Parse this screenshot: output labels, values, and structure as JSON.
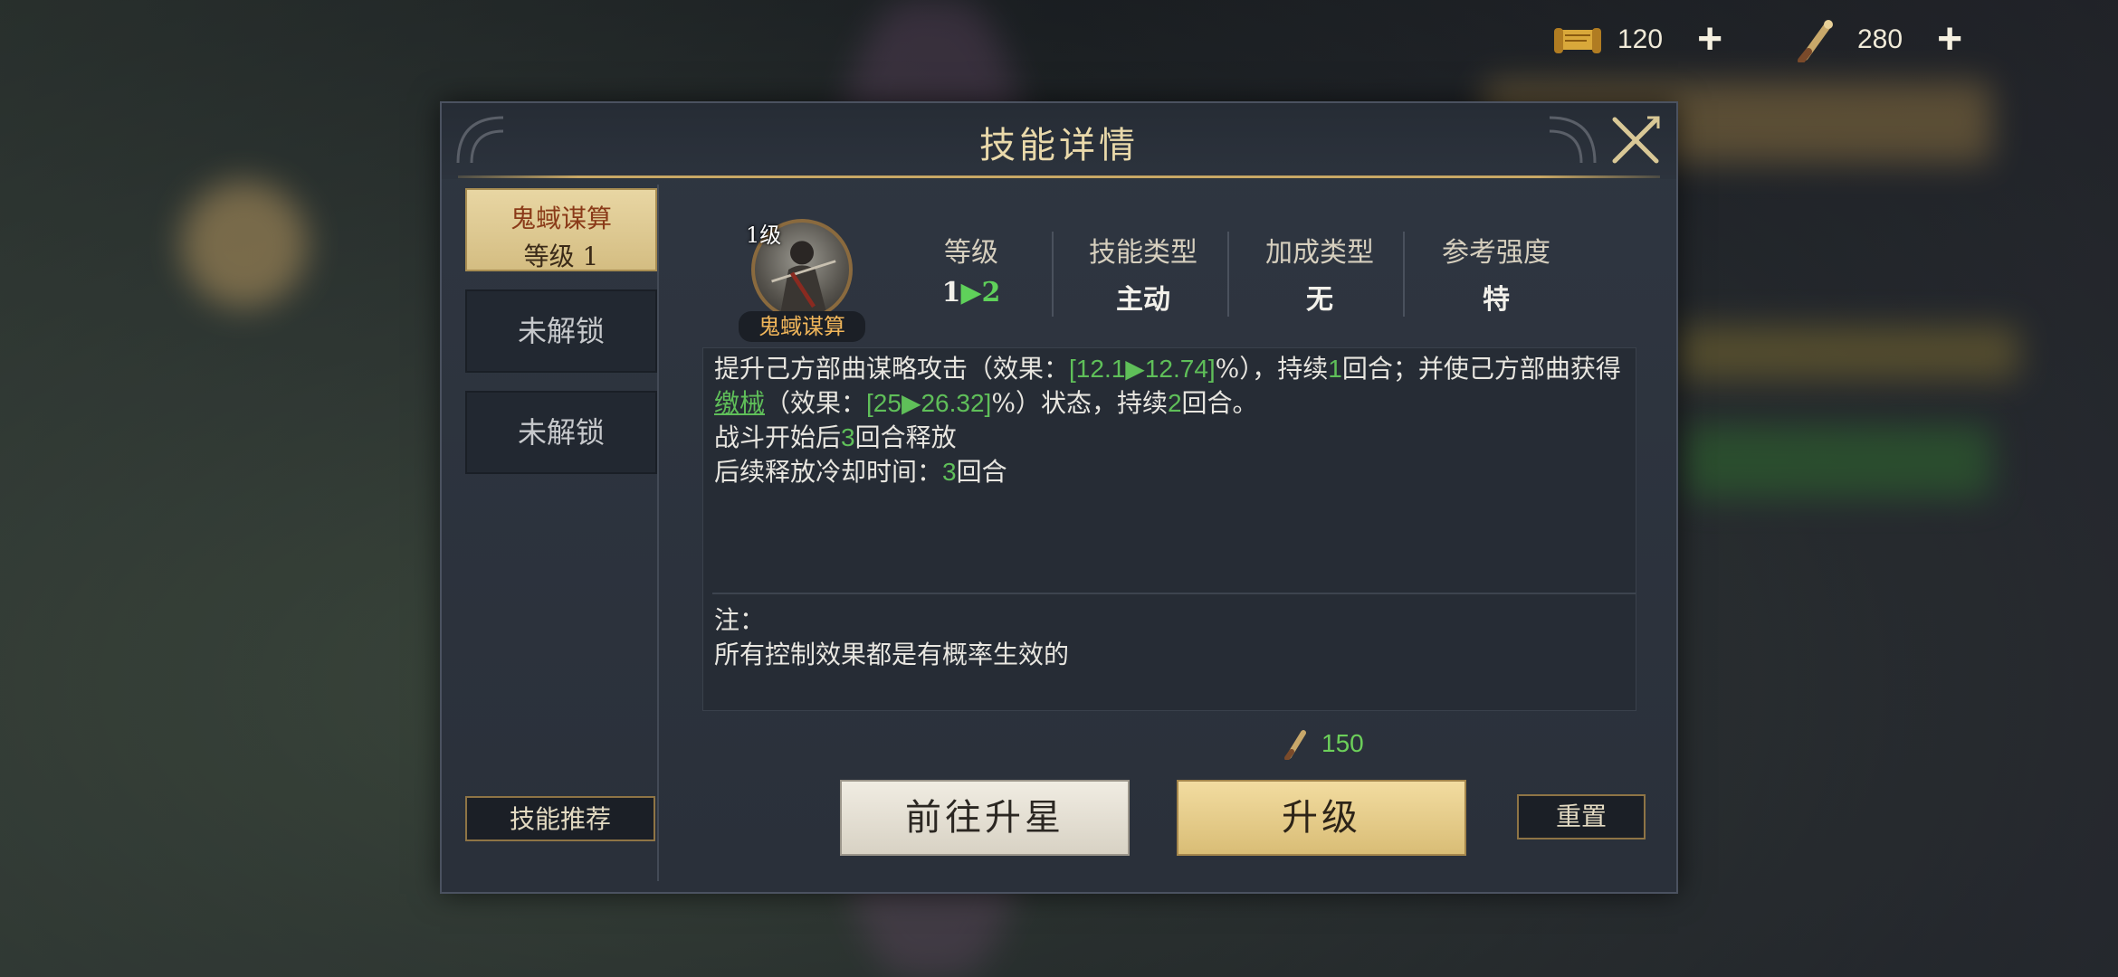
{
  "currencies": [
    {
      "icon": "scroll-icon",
      "amount": "120"
    },
    {
      "icon": "brush-icon",
      "amount": "280"
    }
  ],
  "dialog": {
    "title": "技能详情",
    "slots": {
      "active": {
        "name": "鬼蜮谋算",
        "level": "等级 1"
      },
      "locked1": "未解锁",
      "locked2": "未解锁"
    },
    "recommend_label": "技能推荐",
    "skill": {
      "level_badge": "1级",
      "name": "鬼蜮谋算"
    },
    "stats": {
      "level": {
        "label": "等级",
        "from": "1",
        "arrow": "▶",
        "to": "2"
      },
      "skill_type": {
        "label": "技能类型",
        "value": "主动"
      },
      "bonus_type": {
        "label": "加成类型",
        "value": "无"
      },
      "reference": {
        "label": "参考强度",
        "value": "特"
      }
    },
    "description": {
      "p1_a": "提升己方部曲谋略攻击（效果：",
      "p1_val": "[12.1▶12.74]",
      "p1_b": "%），持续",
      "p1_turns": "1",
      "p1_c": "回合；并使己方部曲获得",
      "p1_link": "缴械",
      "p1_d": "（效果：",
      "p1_val2": "[25▶26.32]",
      "p1_e": "%）状态，持续",
      "p1_turns2": "2",
      "p1_f": "回合。",
      "p2_a": "战斗开始后",
      "p2_num": "3",
      "p2_b": "回合释放",
      "p3_a": "后续释放冷却时间：",
      "p3_num": "3",
      "p3_b": "回合"
    },
    "note_label": "注：",
    "note_text": "所有控制效果都是有概率生效的",
    "cost": "150",
    "buttons": {
      "star": "前往升星",
      "upgrade": "升级",
      "reset": "重置"
    }
  }
}
